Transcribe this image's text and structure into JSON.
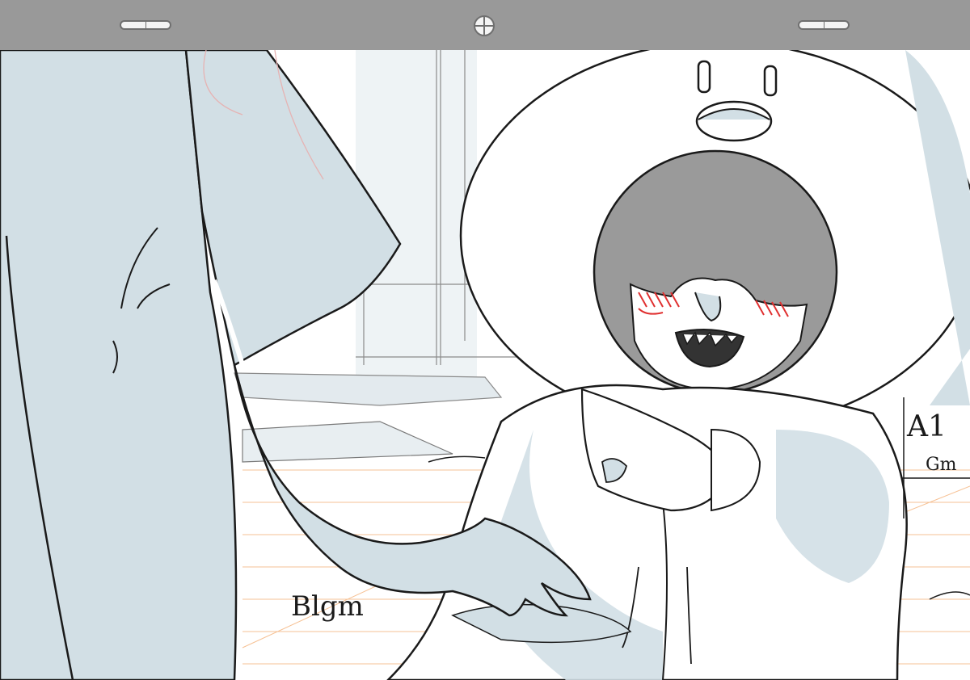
{
  "annotations": {
    "layer_a": "A1",
    "layer_a_sub": "Gm",
    "layer_b": "Blgm"
  },
  "colors": {
    "peg_bar": "#999999",
    "line": "#1a1a1a",
    "shadow_blue": "#d2dfe5",
    "hair_gray": "#9a9a9a",
    "blush_red": "#e03030",
    "guide_orange": "#f5b27a"
  }
}
